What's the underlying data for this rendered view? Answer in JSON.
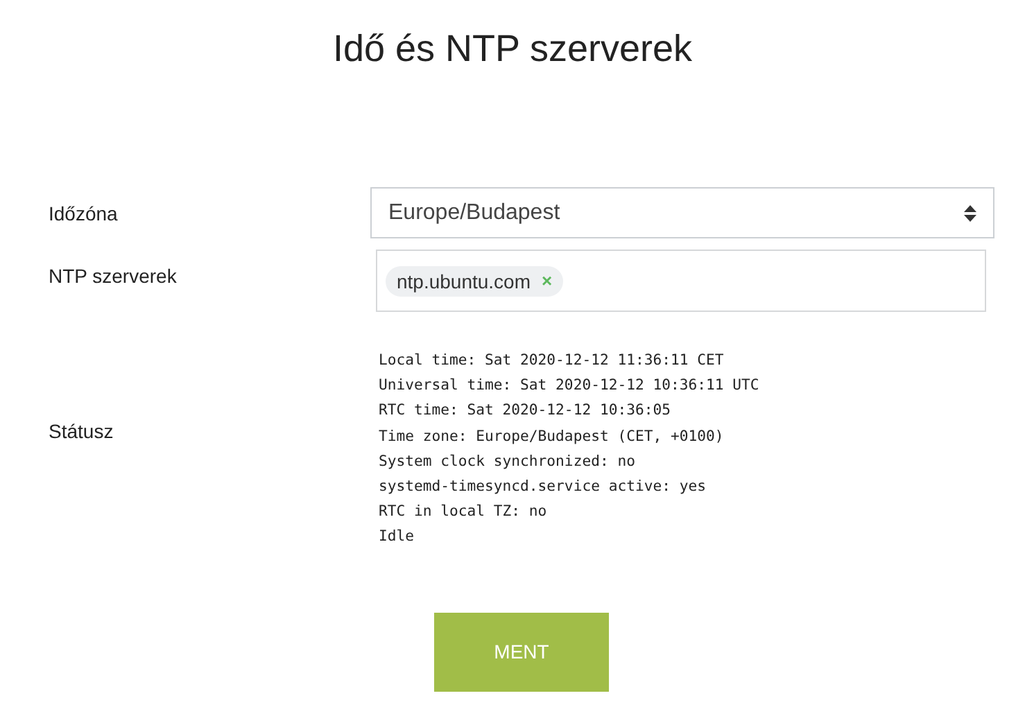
{
  "title": "Idő és NTP szerverek",
  "fields": [
    {
      "kind": "select",
      "label": "Időzóna",
      "value": "Europe/Budapest"
    },
    {
      "kind": "tags",
      "label": "NTP szerverek",
      "tags": [
        "ntp.ubuntu.com"
      ],
      "remove": "×"
    },
    {
      "kind": "status",
      "label": "Státusz",
      "lines": [
        "Local time: Sat 2020-12-12 11:36:11 CET",
        "Universal time: Sat 2020-12-12 10:36:11 UTC",
        "RTC time: Sat 2020-12-12 10:36:05",
        "Time zone: Europe/Budapest (CET, +0100)",
        "System clock synchronized: no",
        "systemd-timesyncd.service active: yes",
        "RTC in local TZ: no",
        "Idle"
      ]
    }
  ],
  "button": "MENT"
}
